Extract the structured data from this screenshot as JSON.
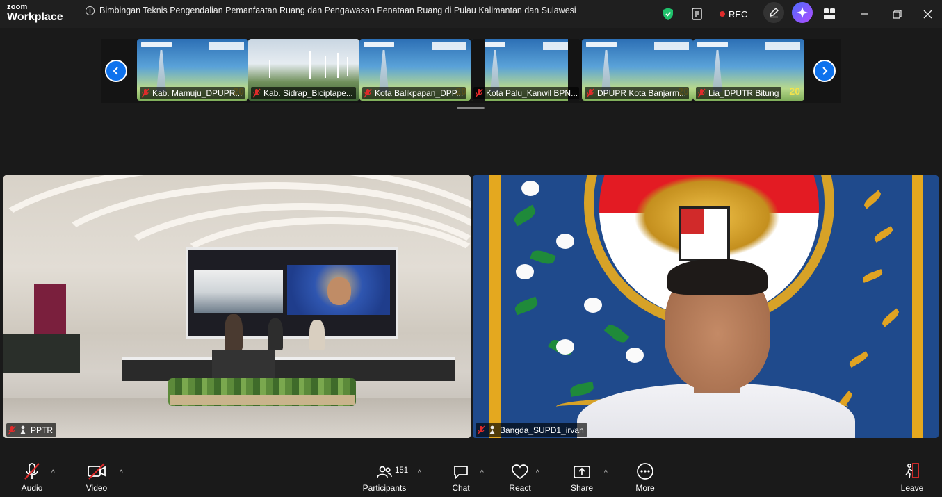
{
  "app": {
    "brand_top": "zoom",
    "brand_bottom": "Workplace",
    "meeting_title": "Bimbingan Teknis Pengendalian Pemanfaatan Ruang  dan Pengawasan Penataan Ruang di Pulau Kalimantan dan Sulawesi",
    "rec_label": "REC"
  },
  "thumbnails": [
    {
      "name": "Kab. Mamuju_DPUPR...",
      "type": "slide"
    },
    {
      "name": "Kab. Sidrap_Biciptape...",
      "type": "wind"
    },
    {
      "name": "Kota Balikpapan_DPP...",
      "type": "slide"
    },
    {
      "name": "Kota Palu_Kanwil BPN...",
      "type": "slide"
    },
    {
      "name": "DPUPR Kota Banjarm...",
      "type": "slide"
    },
    {
      "name": "Lia_DPUTR Bitung",
      "type": "slide"
    }
  ],
  "videos": {
    "left_label": "PPTR",
    "right_label": "Bangda_SUPD1_irvan"
  },
  "toolbar": {
    "audio": "Audio",
    "video": "Video",
    "participants": "Participants",
    "participants_count": "151",
    "chat": "Chat",
    "react": "React",
    "share": "Share",
    "more": "More",
    "leave": "Leave"
  },
  "colors": {
    "accent": "#0e72ed",
    "shield": "#1fc16b",
    "rec": "#e02b2b",
    "mic_off": "#e02b2b",
    "leave": "#e02b2b"
  }
}
